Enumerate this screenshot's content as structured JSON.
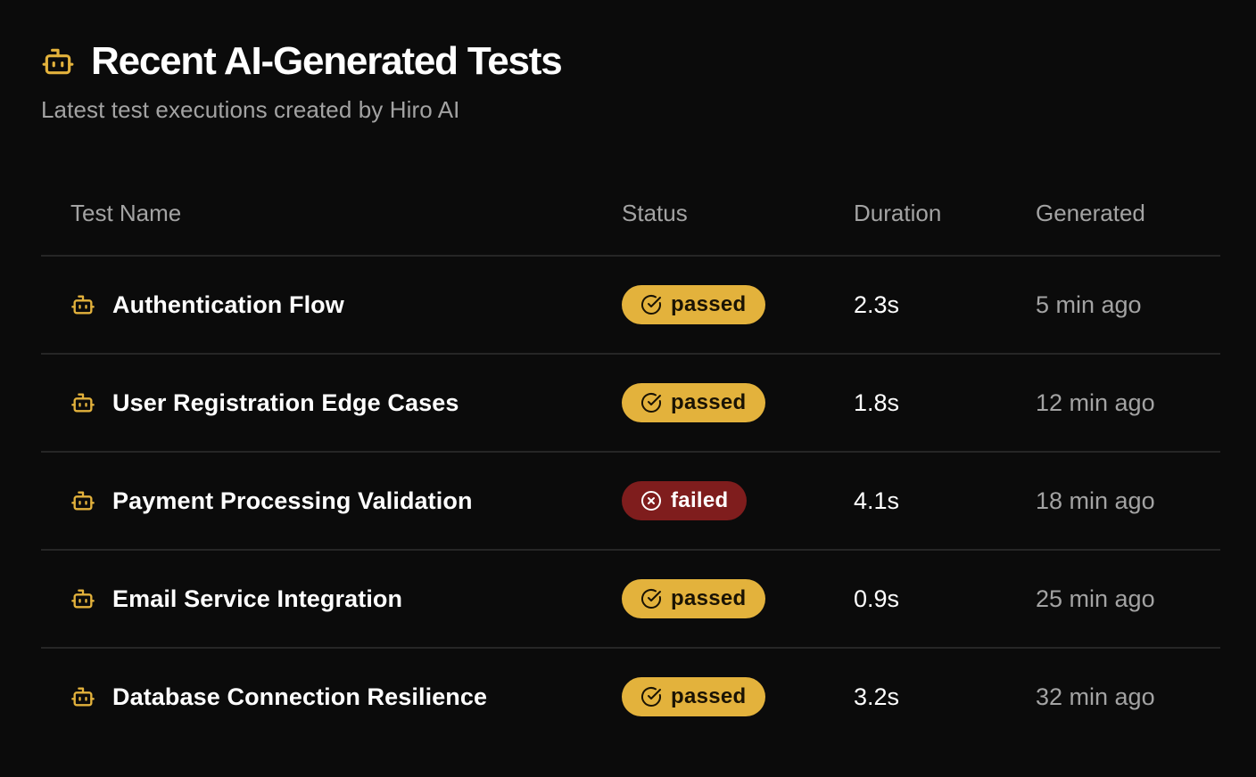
{
  "header": {
    "icon": "robot-icon",
    "title": "Recent AI-Generated Tests",
    "subtitle": "Latest test executions created by Hiro AI"
  },
  "colors": {
    "background": "#0b0b0b",
    "accent": "#e3b23c",
    "passed_bg": "#e3b23c",
    "failed_bg": "#7f1d1d",
    "muted_text": "#a3a3a3",
    "divider": "#262626"
  },
  "table": {
    "columns": [
      "Test Name",
      "Status",
      "Duration",
      "Generated"
    ],
    "rows": [
      {
        "icon": "robot-icon",
        "name": "Authentication Flow",
        "status": "passed",
        "duration": "2.3s",
        "generated": "5 min ago"
      },
      {
        "icon": "robot-icon",
        "name": "User Registration Edge Cases",
        "status": "passed",
        "duration": "1.8s",
        "generated": "12 min ago"
      },
      {
        "icon": "robot-icon",
        "name": "Payment Processing Validation",
        "status": "failed",
        "duration": "4.1s",
        "generated": "18 min ago"
      },
      {
        "icon": "robot-icon",
        "name": "Email Service Integration",
        "status": "passed",
        "duration": "0.9s",
        "generated": "25 min ago"
      },
      {
        "icon": "robot-icon",
        "name": "Database Connection Resilience",
        "status": "passed",
        "duration": "3.2s",
        "generated": "32 min ago"
      }
    ]
  }
}
